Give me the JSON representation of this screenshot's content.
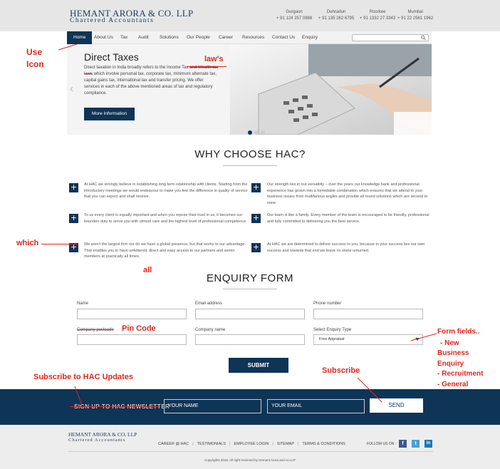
{
  "header": {
    "logo_name": "HEMANT ARORA & CO. LLP",
    "logo_sub": "Chartered Accountants",
    "offices": [
      {
        "city": "Gurgaon",
        "phone": "+ 91 124 257 0888"
      },
      {
        "city": "Dehradun",
        "phone": "+ 91 135 262 6795"
      },
      {
        "city": "Roorkee",
        "phone": "+ 91 1332 27 3343"
      },
      {
        "city": "Mumbai",
        "phone": "+ 91 22 2561 1962"
      }
    ]
  },
  "nav": {
    "items": [
      "Home",
      "About Us",
      "Tax",
      "Audit",
      "Solutions",
      "Our People",
      "Career",
      "Resources",
      "Contact Us",
      "Enquiry"
    ],
    "search_placeholder": ""
  },
  "banner": {
    "title": "Direct Taxes",
    "text_part1": "Direct taxation in India broadly refers to the Income Tax ",
    "text_struck": "and Wealth tax laws",
    "text_part2": " which involve personal tax, corporate tax, minimum alternate tax, capital gains tax, international tax and transfer pricing. We offer services in each of the above mentioned areas of tax and regulatory compliance.",
    "button": "More Information",
    "arrow": "‹"
  },
  "why": {
    "title": "WHY CHOOSE HAC?",
    "items": [
      "At HAC we strongly believe in establishing long term relationship with clients. Starting from the introductory meetings we would endeavour to make you feel the difference in quality of service that you can expect and shall receive.",
      "Our strength lies in our versatility – over the years our knowledge bank and professional experience has grown into a formidable combination which ensures that we attend to your business issues from multifarious angles and provide all round solutions which are second to none.",
      "To us every client is equally important and when you repose their trust in us, it becomes our bounden duty to serve you with utmost care and the highest level of professional competence.",
      "Our team is like a family. Every member of the team is encouraged to be friendly, professional and fully committed to delivering you the best service.",
      "We aren't the largest firm nor do we have a global presence, but that works to our advantage. That enables you to have unfettered, direct and easy access to our partners and senior members at practically all times.",
      "At HAC we are determined to deliver success to you, because in your success lies our own success and towards that end we leave no stone unturned."
    ],
    "plus": "+"
  },
  "enquiry": {
    "title": "ENQUIRY FORM",
    "fields": {
      "name": "Name",
      "email": "Email address",
      "phone": "Phone number",
      "postcode": "Company postcode",
      "company": "Company name",
      "type": "Select Enquiry Type"
    },
    "type_selected": "Free Appraisal",
    "submit": "SUBMIT"
  },
  "newsletter": {
    "label": "SIGN UP TO HAC NEWSLETTER",
    "name_placeholder": "YOUR NAME",
    "email_placeholder": "YOUR EMAIL",
    "send": "SEND"
  },
  "footer": {
    "logo_name": "HEMANT ARORA & CO. LLP",
    "logo_sub": "Chartered Accountants",
    "links": [
      "CAREER @ HAC",
      "TESTIMONIALS",
      "EMPLOYEE LOGIN",
      "SITEMAP",
      "TERMS & CONDITIONS"
    ],
    "follow": "FOLLOW US ON :",
    "social": [
      {
        "name": "facebook",
        "glyph": "f",
        "color": "#3b5998"
      },
      {
        "name": "twitter",
        "glyph": "t",
        "color": "#4a9fd8"
      },
      {
        "name": "linkedin",
        "glyph": "in",
        "color": "#1a7ab8"
      }
    ],
    "copyright": "Copyrights 2016. All right reserved by Hemant Arora and co.LLP"
  },
  "annotations": {
    "use_icon_1": "Use",
    "use_icon_2": "Icon",
    "laws": "law's",
    "which": "which",
    "all": "all",
    "pin_code": "Pin Code",
    "form_fields": [
      "Form fields..",
      "- New",
      "Business",
      "Enquiry",
      "- Recruitment",
      "- General"
    ],
    "subscribe_updates": "Subscribe to HAC Updates",
    "subscribe": "Subscribe",
    "red_color": "#e0271f"
  },
  "colors": {
    "navy": "#0e3456",
    "annotation_red": "#e0271f"
  }
}
